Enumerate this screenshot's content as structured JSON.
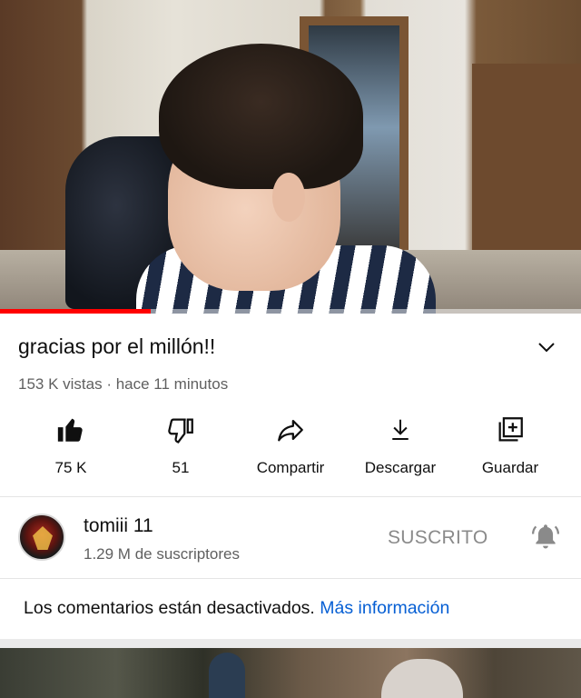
{
  "video": {
    "title": "gracias por el millón!!",
    "meta": "153 K vistas · hace 11 minutos",
    "progress_percent": 26
  },
  "actions": {
    "like_label": "75 K",
    "dislike_label": "51",
    "share_label": "Compartir",
    "download_label": "Descargar",
    "save_label": "Guardar"
  },
  "channel": {
    "name": "tomiii 11",
    "subscribers": "1.29 M de suscriptores",
    "subscribe_state": "SUSCRITO"
  },
  "comments": {
    "disabled_text": "Los comentarios están desactivados.",
    "more_info_link": "Más información"
  },
  "icons": {
    "like": "thumbs-up-icon",
    "dislike": "thumbs-down-icon",
    "share": "share-arrow-icon",
    "download": "download-icon",
    "save": "add-to-playlist-icon",
    "expand": "chevron-down-icon",
    "notifications": "bell-icon"
  },
  "colors": {
    "progress": "#ff0000",
    "link": "#065fd4",
    "secondary_text": "#606060"
  }
}
